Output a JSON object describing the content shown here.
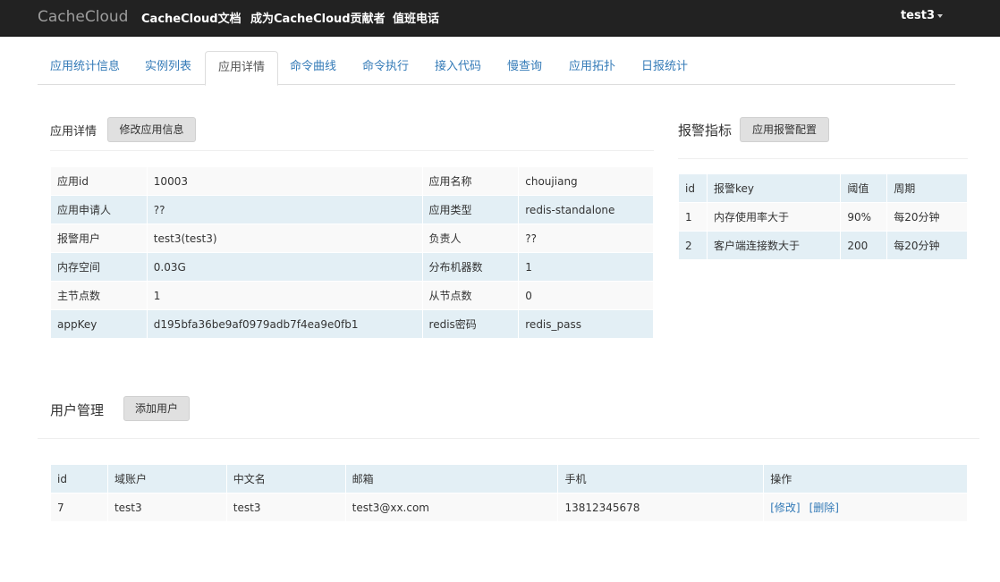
{
  "navbar": {
    "brand": "CacheCloud",
    "links": [
      "CacheCloud文档",
      "成为CacheCloud贡献者",
      "值班电话"
    ],
    "user": "test3"
  },
  "tabs": [
    "应用统计信息",
    "实例列表",
    "应用详情",
    "命令曲线",
    "命令执行",
    "接入代码",
    "慢查询",
    "应用拓扑",
    "日报统计"
  ],
  "active_tab": "应用详情",
  "app_detail": {
    "title": "应用详情",
    "edit_button": "修改应用信息",
    "rows": [
      [
        "应用id",
        "10003",
        "应用名称",
        "choujiang"
      ],
      [
        "应用申请人",
        "??",
        "应用类型",
        "redis-standalone"
      ],
      [
        "报警用户",
        "test3(test3)",
        "负责人",
        "??"
      ],
      [
        "内存空间",
        "0.03G",
        "分布机器数",
        "1"
      ],
      [
        "主节点数",
        "1",
        "从节点数",
        "0"
      ],
      [
        "appKey",
        "d195bfa36be9af0979adb7f4ea9e0fb1",
        "redis密码",
        "redis_pass"
      ]
    ]
  },
  "alarm": {
    "title": "报警指标",
    "config_button": "应用报警配置",
    "headers": [
      "id",
      "报警key",
      "阈值",
      "周期"
    ],
    "rows": [
      [
        "1",
        "内存使用率大于",
        "90%",
        "每20分钟"
      ],
      [
        "2",
        "客户端连接数大于",
        "200",
        "每20分钟"
      ]
    ]
  },
  "users": {
    "title": "用户管理",
    "add_button": "添加用户",
    "headers": [
      "id",
      "域账户",
      "中文名",
      "邮箱",
      "手机",
      "操作"
    ],
    "rows": [
      {
        "id": "7",
        "account": "test3",
        "name": "test3",
        "email": "test3@xx.com",
        "phone": "13812345678",
        "edit": "[修改]",
        "delete": "[删除]"
      }
    ]
  }
}
